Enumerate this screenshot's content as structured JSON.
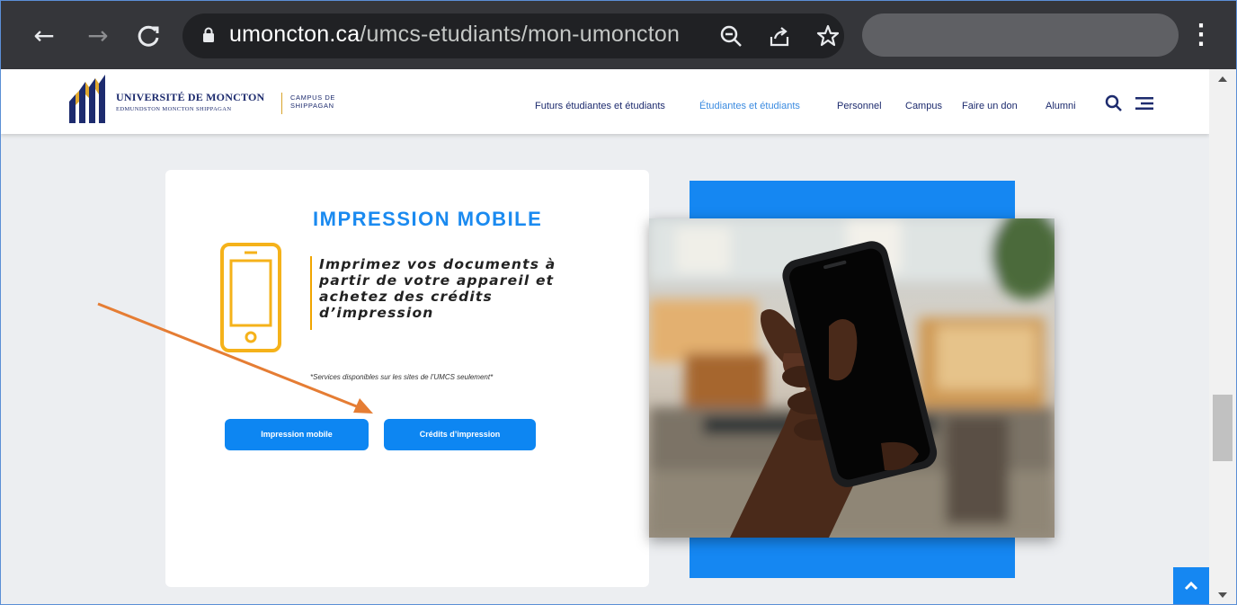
{
  "browser": {
    "url_host": "umoncton.ca",
    "url_path": "/umcs-etudiants/mon-umoncton",
    "icons": [
      "back-arrow-icon",
      "forward-arrow-icon",
      "reload-icon",
      "lock-icon",
      "zoom-out-icon",
      "share-icon",
      "bookmark-star-icon",
      "more-menu-icon"
    ]
  },
  "site": {
    "logo_main": "UNIVERSITÉ DE MONCTON",
    "logo_sub": "EDMUNDSTON MONCTON SHIPPAGAN",
    "logo_campus_1": "CAMPUS DE",
    "logo_campus_2": "SHIPPAGAN",
    "nav": [
      {
        "label": "Futurs étudiantes et étudiants",
        "active": false
      },
      {
        "label": "Étudiantes et étudiants",
        "active": true
      },
      {
        "label": "Personnel",
        "active": false
      },
      {
        "label": "Campus",
        "active": false
      },
      {
        "label": "Faire un don",
        "active": false
      },
      {
        "label": "Alumni",
        "active": false
      }
    ]
  },
  "card": {
    "title": "IMPRESSION MOBILE",
    "text": "Imprimez vos documents à partir de votre appareil et achetez des crédits d’impression",
    "note": "*Services disponibles sur les sites de l’UMCS seulement*",
    "button_mobile": "Impression mobile",
    "button_credits": "Crédits d’impression"
  },
  "colors": {
    "accent_blue": "#0d86f2",
    "title_blue": "#1a8af0",
    "gold": "#f0a500",
    "navy": "#1d2b6e",
    "annotation_arrow": "#e57d34"
  }
}
